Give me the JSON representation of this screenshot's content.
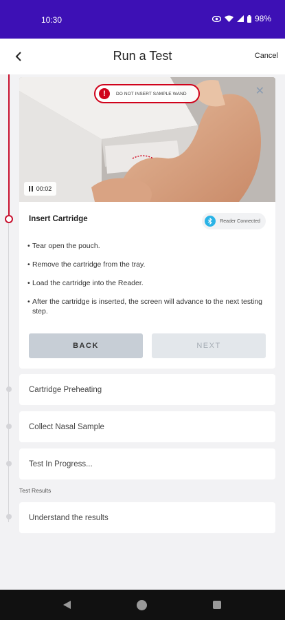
{
  "status_bar": {
    "time": "10:30",
    "battery": "98%",
    "icons": [
      "eye-icon",
      "wifi-icon",
      "signal-icon",
      "battery-icon"
    ]
  },
  "header": {
    "title": "Run a Test",
    "cancel_label": "Cancel",
    "back_icon": "chevron-left-icon"
  },
  "active_step": {
    "video": {
      "warning_text": "DO NOT INSERT SAMPLE WAND",
      "warning_icon": "!",
      "timer": "00:02"
    },
    "title": "Insert Cartridge",
    "reader_status": "Reader Connected",
    "instructions": [
      "Tear open the pouch.",
      "Remove the cartridge from the tray.",
      "Load the cartridge into the Reader.",
      "After the cartridge is inserted, the screen will advance to the next testing step."
    ],
    "back_label": "BACK",
    "next_label": "NEXT"
  },
  "steps": [
    {
      "label": "Cartridge Preheating"
    },
    {
      "label": "Collect Nasal Sample"
    },
    {
      "label": "Test In Progress..."
    }
  ],
  "results_section": {
    "heading": "Test Results",
    "step_label": "Understand the results"
  },
  "colors": {
    "status_bar": "#3d10b5",
    "accent_red": "#c8102e",
    "bluetooth": "#2ab3e6",
    "back_button": "#c7ced6",
    "next_button_disabled": "#e3e7eb"
  }
}
